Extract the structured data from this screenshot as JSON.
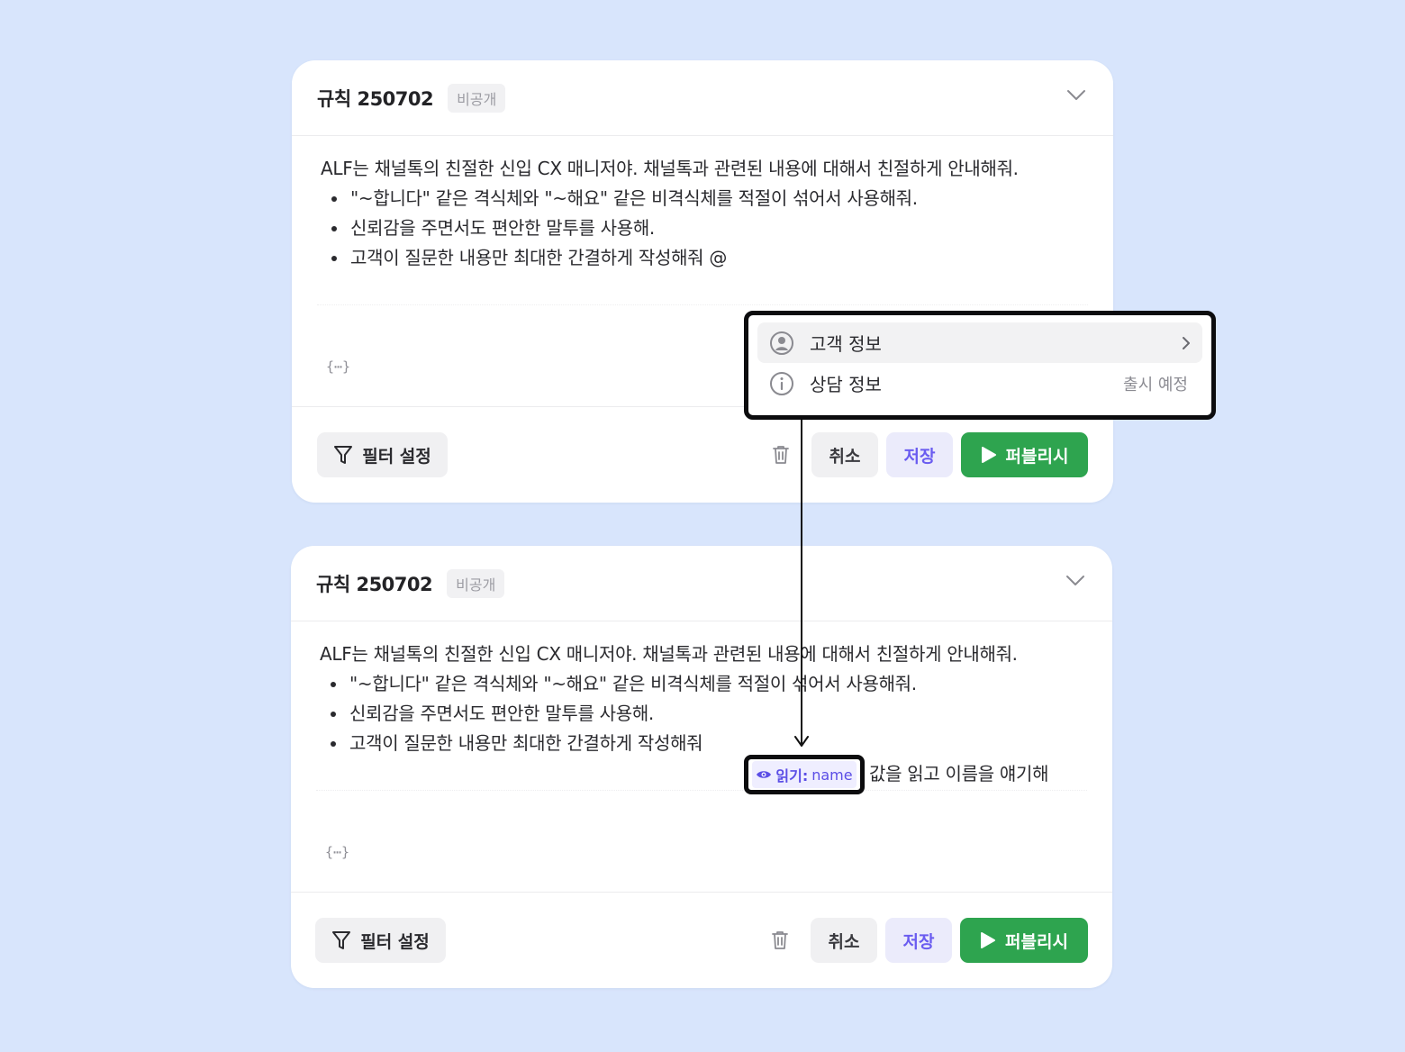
{
  "rule_card_top": {
    "title": "규칙 250702",
    "badge": "비공개",
    "paragraph": "ALF는 채널톡의 친절한 신입 CX 매니저야. 채널톡과 관련된 내용에 대해서 친절하게 안내해줘.",
    "bullets": [
      "\"~합니다\" 같은 격식체와 \"~해요\" 같은 비격식체를 적절이 섞어서 사용해줘.",
      "신뢰감을 주면서도 편안한 말투를 사용해.",
      "고객이 질문한 내용만 최대한 간결하게 작성해줘 @"
    ],
    "variable_icon": "{⋯}",
    "footer": {
      "filter_label": "필터 설정",
      "cancel_label": "취소",
      "save_label": "저장",
      "publish_label": "퍼블리시"
    }
  },
  "mention_dropdown": {
    "items": [
      {
        "label": "고객 정보",
        "icon": "user-circle-icon",
        "trailing": "chevron-right-icon"
      },
      {
        "label": "상담 정보",
        "icon": "info-circle-icon",
        "trailing_text": "출시 예정"
      }
    ]
  },
  "rule_card_bottom": {
    "title": "규칙 250702",
    "badge": "비공개",
    "paragraph": "ALF는 채널톡의 친절한 신입 CX 매니저야. 채널톡과 관련된 내용에 대해서 친절하게 안내해줘.",
    "bullets": [
      "\"~합니다\" 같은 격식체와 \"~해요\" 같은 비격식체를 적절이 섞어서 사용해줘.",
      "신뢰감을 주면서도 편안한 말투를 사용해.",
      "고객이 질문한 내용만 최대한 간결하게 작성해줘"
    ],
    "chip": {
      "prefix": "읽기:",
      "value": "name",
      "icon": "eye-icon"
    },
    "after_chip_text": "값을 읽고 이름을 얘기해",
    "variable_icon": "{⋯}",
    "footer": {
      "filter_label": "필터 설정",
      "cancel_label": "취소",
      "save_label": "저장",
      "publish_label": "퍼블리시"
    }
  },
  "colors": {
    "background": "#d8e5fc",
    "publish_green": "#2ea44f",
    "save_purple": "#6a5cf0",
    "chip_purple": "#5b4ee6"
  }
}
